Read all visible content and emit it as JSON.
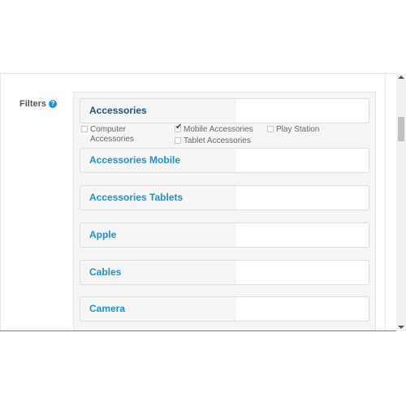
{
  "filters": {
    "label": "Filters",
    "help_icon": "?"
  },
  "groups": [
    {
      "title": "Accessories",
      "expanded": true,
      "options": [
        {
          "label": "Computer Accessories",
          "checked": false
        },
        {
          "label": "Mobile Accessories",
          "checked": true
        },
        {
          "label": "Play Station",
          "checked": false
        },
        {
          "label": "Tablet Accessories",
          "checked": false
        }
      ]
    },
    {
      "title": "Accessories Mobile"
    },
    {
      "title": "Accessories Tablets"
    },
    {
      "title": "Apple"
    },
    {
      "title": "Cables"
    },
    {
      "title": "Camera"
    }
  ],
  "colors": {
    "link": "#1e91cf",
    "active_link": "#23527c",
    "well_bg": "#f5f5f5",
    "help_badge": "#1e91cf"
  }
}
